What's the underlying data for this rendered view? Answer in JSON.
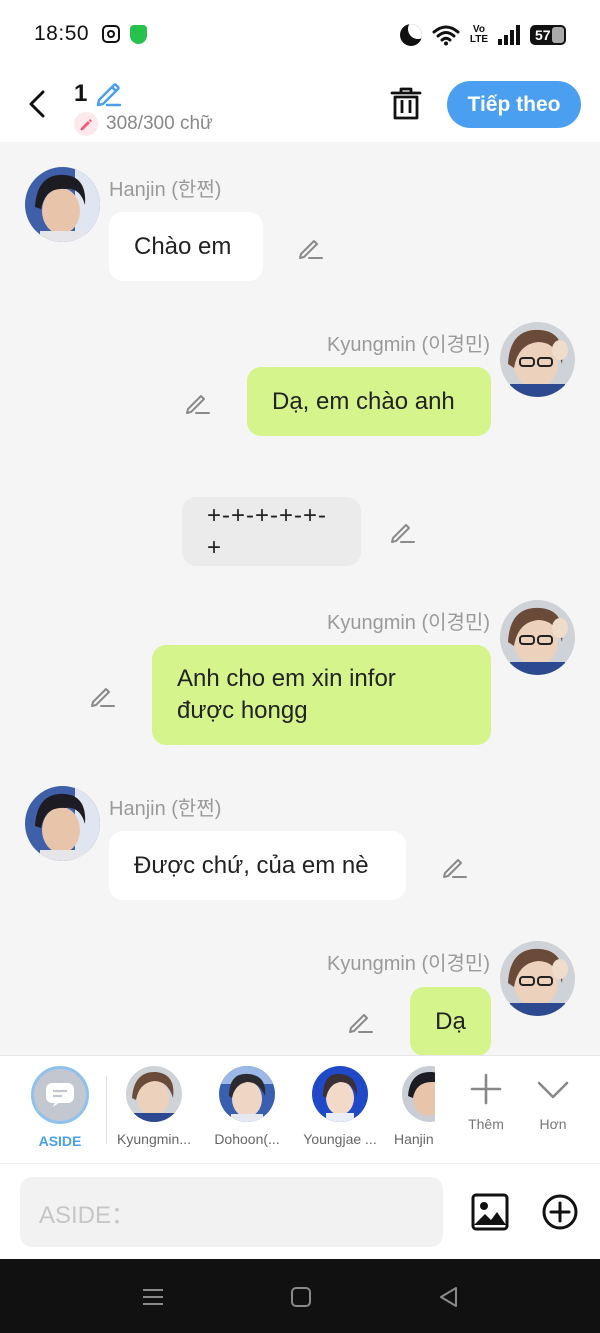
{
  "status_bar": {
    "time": "18:50",
    "volte_top": "Vo",
    "volte_bottom": "LTE",
    "battery": "57"
  },
  "header": {
    "title": "1",
    "char_count": "308/300 chữ",
    "next_label": "Tiếp theo",
    "accent_color": "#4a9ff0"
  },
  "messages": [
    {
      "side": "left",
      "sender": "Hanjin (한쩐)",
      "text": "Chào em",
      "style": "white"
    },
    {
      "side": "right",
      "sender": "Kyungmin (이경민)",
      "text": "Dạ, em chào anh",
      "style": "green"
    },
    {
      "side": "center",
      "sender": "",
      "text": "+-+-+-+-+-+",
      "style": "gray"
    },
    {
      "side": "right",
      "sender": "Kyungmin (이경민)",
      "text_lines": [
        "Anh cho em xin infor",
        "được hongg"
      ],
      "style": "green"
    },
    {
      "side": "left",
      "sender": "Hanjin (한쩐)",
      "text": "Được chứ, của em nè",
      "style": "white"
    },
    {
      "side": "right",
      "sender": "Kyungmin (이경민)",
      "text": "Dạ",
      "style": "green"
    }
  ],
  "characters": {
    "aside": "ASIDE",
    "kyungmin": "Kyungmin...",
    "dohoon": "Dohoon(...",
    "youngjae": "Youngjae ...",
    "hanjin": "Hanjin"
  },
  "tools": {
    "add": "Thêm",
    "more": "Hơn"
  },
  "input": {
    "placeholder": "ASIDE："
  }
}
